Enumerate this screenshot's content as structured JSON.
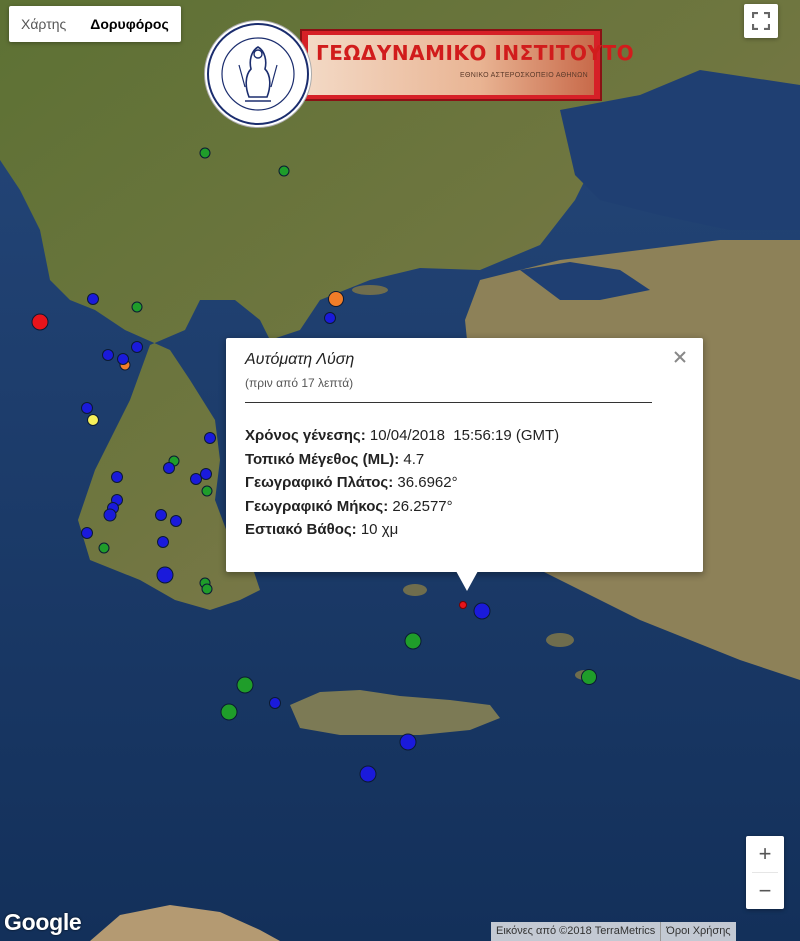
{
  "map_type_control": {
    "map_label": "Χάρτης",
    "satellite_label": "Δορυφόρος",
    "selected": "satellite"
  },
  "logo": {
    "title": "ΓΕΩΔΥΝΑΜΙΚΟ ΙΝΣΤΙΤΟΥΤΟ",
    "subtitle": "ΕΘΝΙΚΟ ΑΣΤΕΡΟΣΚΟΠΕΙΟ ΑΘΗΝΩΝ"
  },
  "popup": {
    "title": "Αυτόματη Λύση",
    "subtitle": "(πριν από 17 λεπτά)",
    "origin_time_label": "Χρόνος γένεσης:",
    "origin_time_value": "10/04/2018  15:56:19 (GMT)",
    "magnitude_label": "Τοπικό Μέγεθος (ML):",
    "magnitude_value": "4.7",
    "latitude_label": "Γεωγραφικό Πλάτος:",
    "latitude_value": "36.6962°",
    "longitude_label": "Γεωγραφικό Μήκος:",
    "longitude_value": "26.2577°",
    "depth_label": "Εστιακό Βάθος:",
    "depth_value": "10 χμ"
  },
  "markers": {
    "legend_colors": {
      "red": "#e8141b",
      "orange": "#f07d28",
      "yellow": "#f6f05a",
      "green": "#1f9d2a",
      "blue": "#1a1adb"
    },
    "selected_marker_color": "#e8141b"
  },
  "zoom": {
    "in_label": "+",
    "out_label": "−"
  },
  "google_logo": "Google",
  "attribution": {
    "imagery": "Εικόνες από ©2018 TerraMetrics",
    "terms": "Όροι Χρήσης"
  }
}
